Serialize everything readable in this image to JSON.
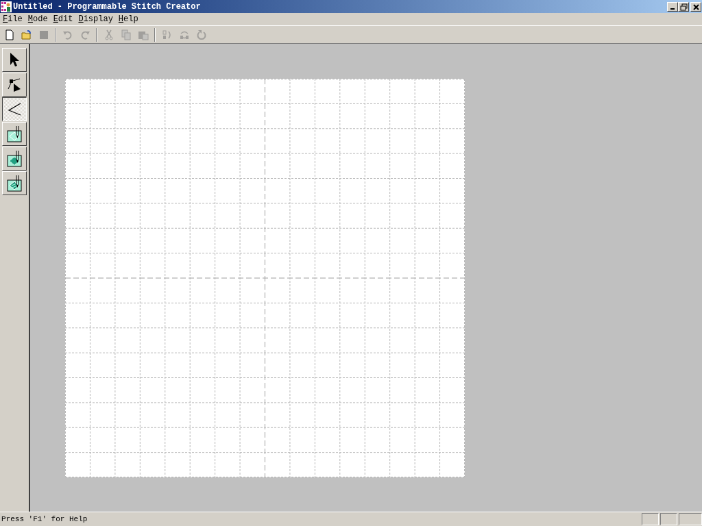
{
  "window": {
    "title": "Untitled - Programmable Stitch Creator"
  },
  "menu": [
    {
      "label": "File"
    },
    {
      "label": "Mode"
    },
    {
      "label": "Edit"
    },
    {
      "label": "Display"
    },
    {
      "label": "Help"
    }
  ],
  "toolbar": [
    {
      "kind": "new",
      "disabled": false
    },
    {
      "kind": "open",
      "disabled": false
    },
    {
      "kind": "save",
      "disabled": true
    },
    {
      "kind": "sep"
    },
    {
      "kind": "undo",
      "disabled": true
    },
    {
      "kind": "redo",
      "disabled": true
    },
    {
      "kind": "sep"
    },
    {
      "kind": "cut",
      "disabled": true
    },
    {
      "kind": "copy",
      "disabled": true
    },
    {
      "kind": "paste",
      "disabled": true
    },
    {
      "kind": "sep"
    },
    {
      "kind": "flip",
      "disabled": true
    },
    {
      "kind": "swap",
      "disabled": true
    },
    {
      "kind": "rotate",
      "disabled": true
    }
  ],
  "tools": [
    {
      "kind": "select",
      "selected": false
    },
    {
      "kind": "node",
      "selected": false
    },
    {
      "kind": "zigzag",
      "selected": true
    },
    {
      "kind": "fill-outline",
      "selected": false
    },
    {
      "kind": "fill-dotted",
      "selected": false
    },
    {
      "kind": "fill-hatched",
      "selected": false
    }
  ],
  "status_bar": {
    "text": "Press 'F1' for Help"
  }
}
